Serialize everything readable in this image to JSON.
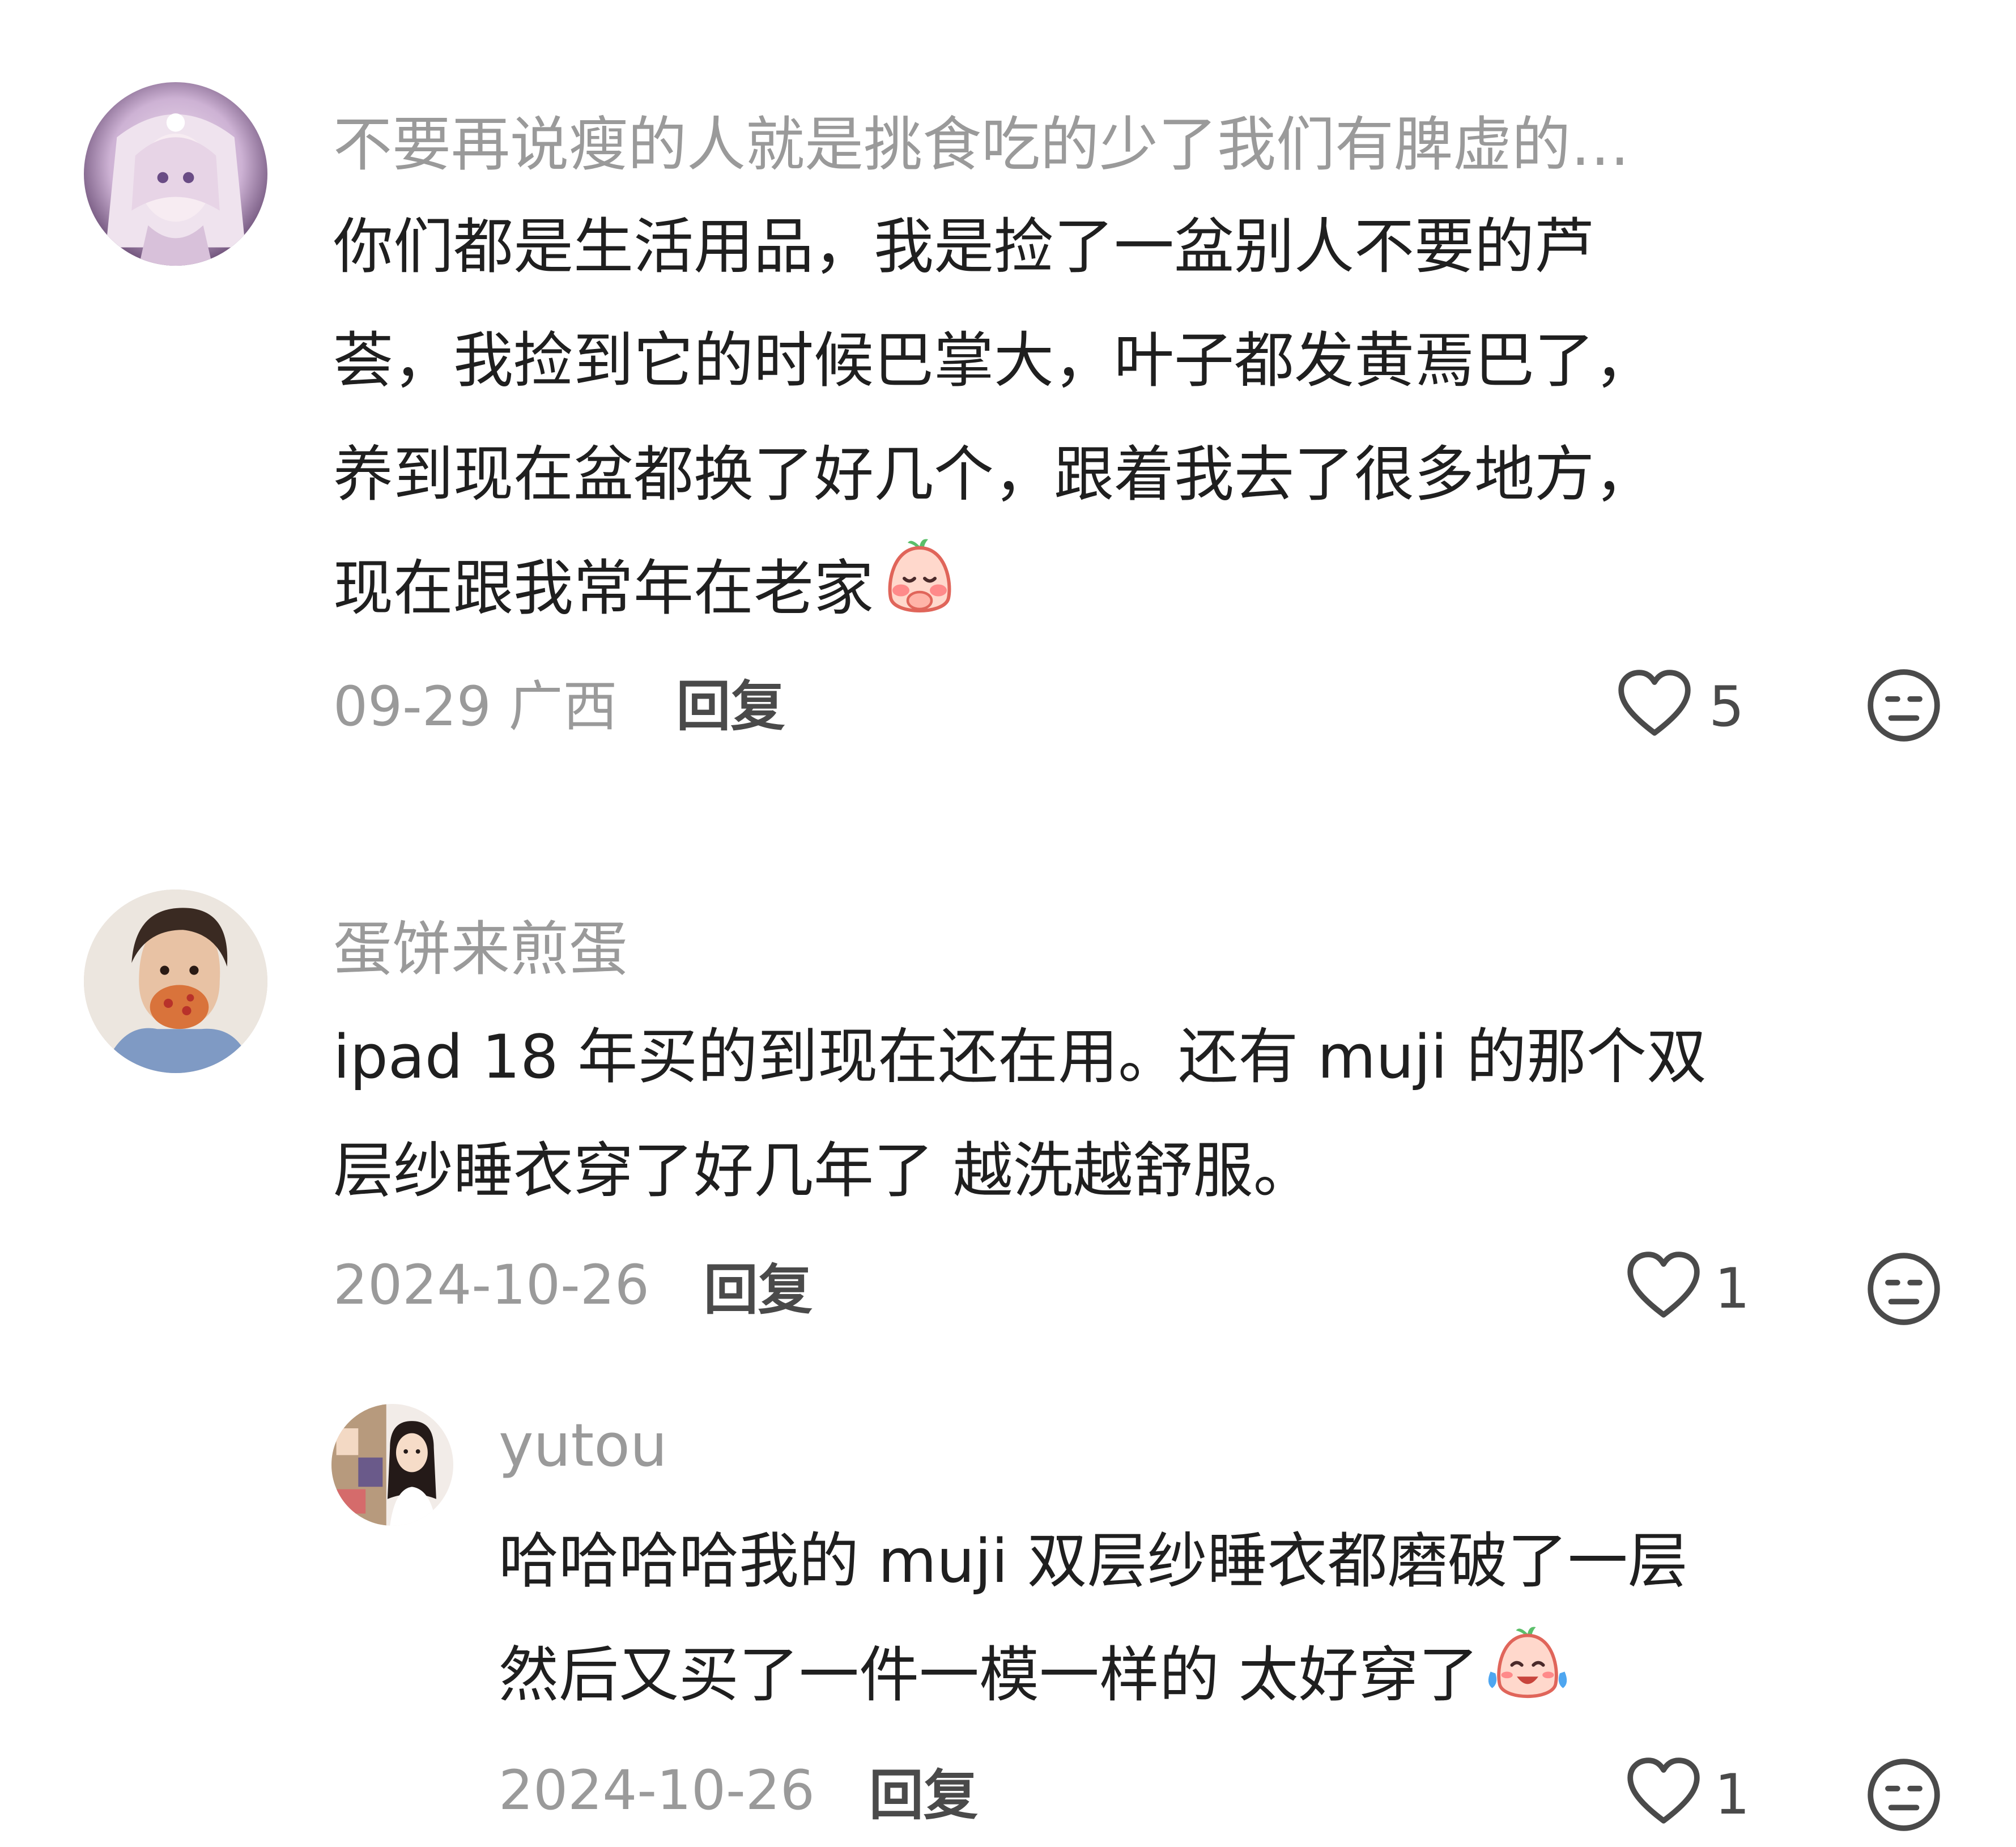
{
  "comments": [
    {
      "username": "不要再说瘦的人就是挑食吃的少了我们有脾虚的…",
      "lines": [
        "你们都是生活用品，我是捡了一盆别人不要的芦",
        "荟，我捡到它的时候巴掌大，叶子都发黄焉巴了，",
        "养到现在盆都换了好几个，跟着我去了很多地方，",
        "现在跟我常年在老家"
      ],
      "emoji": "shy-peach-emoji",
      "time": "09-29 广西",
      "reply_label": "回复",
      "likes": "5"
    },
    {
      "username": "蛋饼来煎蛋",
      "lines": [
        "ipad 18 年买的到现在还在用。还有 muji 的那个双",
        "层纱睡衣穿了好几年了 越洗越舒服。"
      ],
      "time": "2024-10-26",
      "reply_label": "回复",
      "likes": "1",
      "replies": [
        {
          "username": "yutou",
          "lines": [
            "哈哈哈哈我的 muji 双层纱睡衣都磨破了一层",
            "然后又买了一件一模一样的 太好穿了"
          ],
          "emoji": "laugh-cry-peach-emoji",
          "time": "2024-10-26",
          "reply_label": "回复",
          "likes": "1"
        }
      ]
    }
  ]
}
